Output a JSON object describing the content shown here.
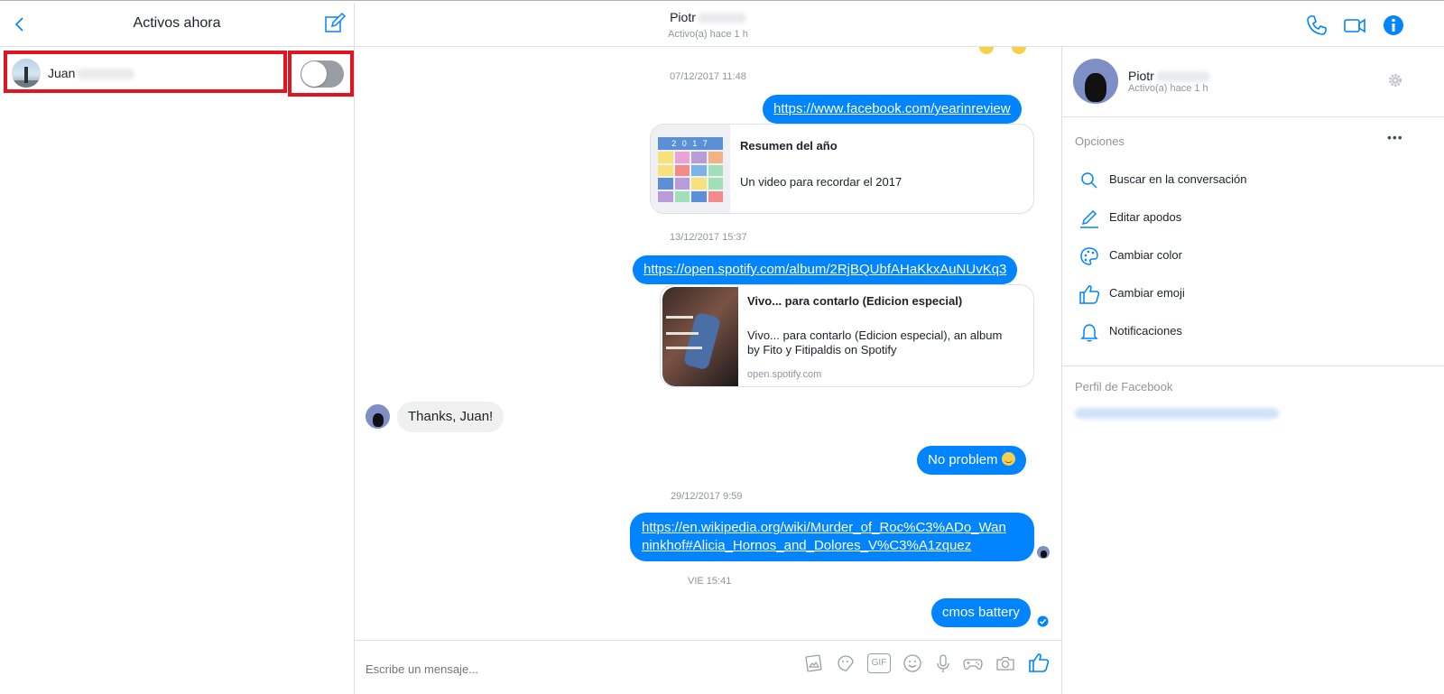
{
  "left": {
    "title": "Activos ahora",
    "active_user_name": "Juan"
  },
  "chat": {
    "name": "Piotr",
    "status": "Activo(a) hace 1 h",
    "messages": {
      "ts1": "07/12/2017 11:48",
      "link1": "https://www.facebook.com/yearinreview",
      "card1_title": "Resumen del año",
      "card1_desc": "Un video para recordar el 2017",
      "card1_img_text": "2 0 1 7",
      "ts2": "13/12/2017 15:37",
      "link2": "https://open.spotify.com/album/2RjBQUbfAHaKkxAuNUvKq3",
      "card2_title": "Vivo... para contarlo (Edicion especial)",
      "card2_desc_line1": "Vivo... para contarlo (Edicion especial), an album",
      "card2_desc_line2": "by Fito y Fitipaldis on Spotify",
      "card2_domain": "open.spotify.com",
      "incoming1": "Thanks, Juan!",
      "outgoing1": "No problem",
      "ts3": "29/12/2017 9:59",
      "link3_line1": "https://en.wikipedia.org/wiki/Murder_of_Roc%C3%ADo_Wan",
      "link3_line2": "ninkhof#Alicia_Hornos_and_Dolores_V%C3%A1zquez",
      "ts4": "VIE 15:41",
      "outgoing2": "cmos battery"
    },
    "composer_placeholder": "Escribe un mensaje...",
    "gif_label": "GIF"
  },
  "info": {
    "name": "Piotr",
    "status": "Activo(a) hace 1 h",
    "options_title": "Opciones",
    "more": "•••",
    "options": [
      {
        "label": "Buscar en la conversación",
        "icon": "search-icon"
      },
      {
        "label": "Editar apodos",
        "icon": "pencil-icon"
      },
      {
        "label": "Cambiar color",
        "icon": "palette-icon"
      },
      {
        "label": "Cambiar emoji",
        "icon": "thumbs-up-icon"
      },
      {
        "label": "Notificaciones",
        "icon": "bell-icon"
      }
    ],
    "profile_title": "Perfil de Facebook"
  },
  "colors": {
    "accent": "#0084ff",
    "highlight": "#e0151f"
  }
}
